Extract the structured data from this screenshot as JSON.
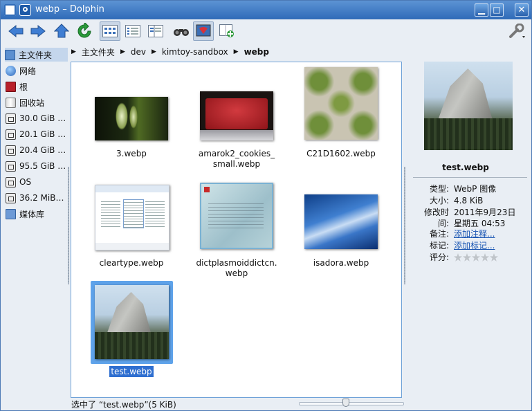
{
  "window": {
    "title": "webp – Dolphin",
    "minimize": "▁",
    "maximize": "□",
    "close": "✕"
  },
  "toolbar": [
    "back-icon",
    "forward-icon",
    "up-icon",
    "reload-icon",
    "icons-view-icon",
    "details-view-icon",
    "columns-view-icon",
    "find-icon",
    "preview-icon",
    "split-icon",
    "configure-icon"
  ],
  "places": [
    {
      "label": "主文件夹",
      "icon": "home-folder-icon",
      "selected": true
    },
    {
      "label": "网络",
      "icon": "network-icon"
    },
    {
      "label": "根",
      "icon": "root-folder-icon"
    },
    {
      "label": "回收站",
      "icon": "trash-icon"
    },
    {
      "label": "30.0 GiB …",
      "icon": "drive-icon"
    },
    {
      "label": "20.1 GiB …",
      "icon": "drive-icon"
    },
    {
      "label": "20.4 GiB …",
      "icon": "drive-icon"
    },
    {
      "label": "95.5 GiB …",
      "icon": "drive-icon"
    },
    {
      "label": "OS",
      "icon": "drive-icon"
    },
    {
      "label": "36.2 MiB…",
      "icon": "drive-icon"
    },
    {
      "label": "媒体库",
      "icon": "media-folder-icon"
    }
  ],
  "breadcrumb": [
    "主文件夹",
    "dev",
    "kimtoy-sandbox",
    "webp"
  ],
  "files": [
    {
      "name": "3.webp"
    },
    {
      "name": "amarok2_cookies_\nsmall.webp"
    },
    {
      "name": "C21D1602.webp"
    },
    {
      "name": "cleartype.webp"
    },
    {
      "name": "dictplasmoiddictcn.\nwebp"
    },
    {
      "name": "isadora.webp"
    },
    {
      "name": "test.webp",
      "selected": true
    }
  ],
  "status": "选中了 “test.webp”(5 KiB)",
  "zoom": {
    "level": 0.45
  },
  "info": {
    "filename": "test.webp",
    "rows": [
      {
        "label": "类型:",
        "value": "WebP 图像"
      },
      {
        "label": "大小:",
        "value": "4.8 KiB"
      },
      {
        "label": "修改时间:",
        "value": "2011年9月23日 星期五 04:53"
      },
      {
        "label": "备注:",
        "value": "添加注释...",
        "link": true
      },
      {
        "label": "标记:",
        "value": "添加标记...",
        "link": true
      },
      {
        "label": "评分:",
        "value": ""
      }
    ],
    "rating": 0
  }
}
